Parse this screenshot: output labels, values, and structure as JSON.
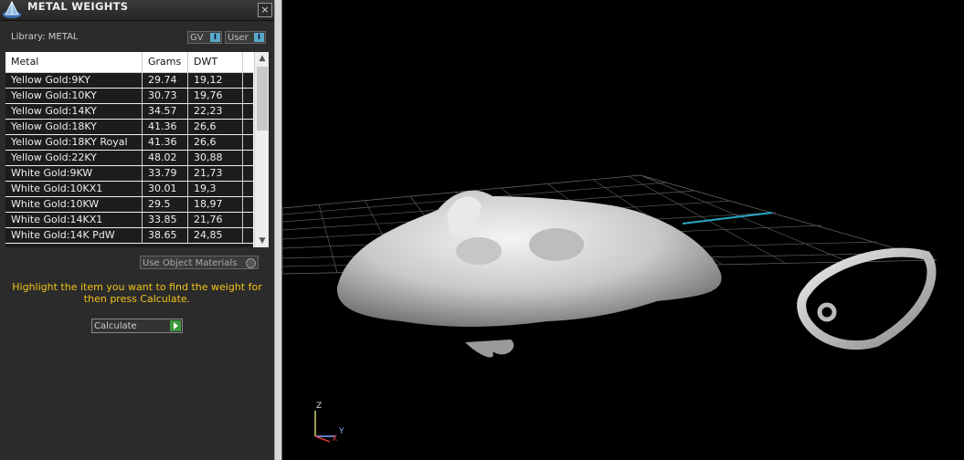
{
  "window": {
    "title": "METAL WEIGHTS",
    "close_label": "×"
  },
  "library": {
    "label": "Library: METAL",
    "gv_label": "GV",
    "user_label": "User",
    "toggle_glyph": "I"
  },
  "table": {
    "headers": [
      "Metal",
      "Grams",
      "DWT"
    ],
    "rows": [
      [
        "Yellow Gold:9KY",
        "29.74",
        "19,12"
      ],
      [
        "Yellow Gold:10KY",
        "30.73",
        "19,76"
      ],
      [
        "Yellow Gold:14KY",
        "34.57",
        "22,23"
      ],
      [
        "Yellow Gold:18KY",
        "41.36",
        "26,6"
      ],
      [
        "Yellow Gold:18KY Royal",
        "41.36",
        "26,6"
      ],
      [
        "Yellow Gold:22KY",
        "48.02",
        "30,88"
      ],
      [
        "White Gold:9KW",
        "33.79",
        "21,73"
      ],
      [
        "White Gold:10KX1",
        "30.01",
        "19,3"
      ],
      [
        "White Gold:10KW",
        "29.5",
        "18,97"
      ],
      [
        "White Gold:14KX1",
        "33.85",
        "21,76"
      ],
      [
        "White Gold:14K PdW",
        "38.65",
        "24,85"
      ]
    ]
  },
  "use_object_materials": "Use Object Materials",
  "hint": "Highlight the item you want to find the weight for then press Calculate.",
  "calculate_label": "Calculate",
  "axis": {
    "z": "Z",
    "y": "Y",
    "x": "X"
  },
  "colors": {
    "hint": "#f2c318",
    "calc_go": "#3c9a3c",
    "toggle": "#5aa8c8",
    "highlight_line": "#2aa7c9"
  }
}
